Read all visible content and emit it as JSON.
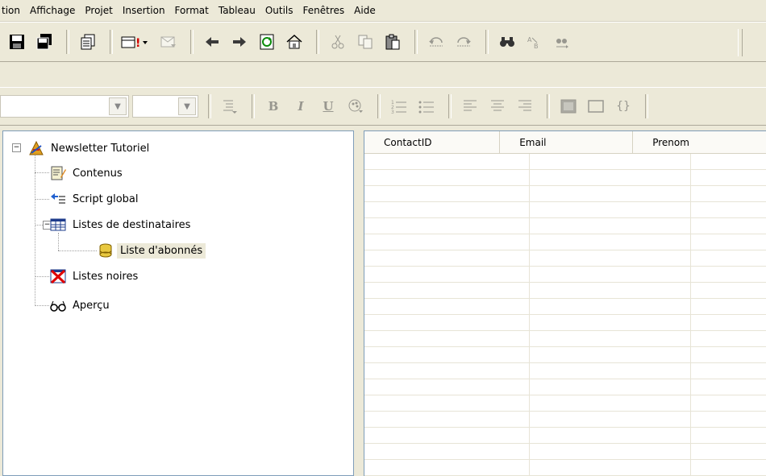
{
  "menubar": {
    "items": [
      "tion",
      "Affichage",
      "Projet",
      "Insertion",
      "Format",
      "Tableau",
      "Outils",
      "Fenêtres",
      "Aide"
    ]
  },
  "toolbar_main": {
    "icons": [
      "save-icon",
      "save-all-icon",
      "copy-document-icon",
      "send-test-icon",
      "preview-mail-icon",
      "back-arrow-icon",
      "forward-arrow-icon",
      "refresh-icon",
      "home-icon",
      "cut-icon",
      "copy-icon",
      "paste-icon",
      "undo-icon",
      "redo-icon",
      "find-icon",
      "replace-icon",
      "find-next-icon"
    ]
  },
  "toolbar_format": {
    "font_combo": "",
    "size_combo": "",
    "icons": [
      "paragraph-style-icon",
      "bold-icon",
      "italic-icon",
      "underline-icon",
      "color-icon",
      "numbered-list-icon",
      "bullet-list-icon",
      "align-left-icon",
      "align-center-icon",
      "align-right-icon",
      "image-icon",
      "frame-icon",
      "code-icon"
    ]
  },
  "tree": {
    "root": "Newsletter Tutoriel",
    "items": [
      {
        "label": "Contenus",
        "icon": "document-edit-icon"
      },
      {
        "label": "Script global",
        "icon": "script-icon"
      },
      {
        "label": "Listes de destinataires",
        "icon": "table-icon"
      },
      {
        "label": "Liste d'abonnés",
        "icon": "database-icon"
      },
      {
        "label": "Listes noires",
        "icon": "blacklist-icon"
      },
      {
        "label": "Aperçu",
        "icon": "glasses-icon"
      }
    ]
  },
  "grid": {
    "columns": [
      "ContactID",
      "Email",
      "Prenom"
    ]
  },
  "colors": {
    "chrome": "#ece9d8",
    "border": "#7f9db9",
    "selection": "#ece9d8"
  }
}
